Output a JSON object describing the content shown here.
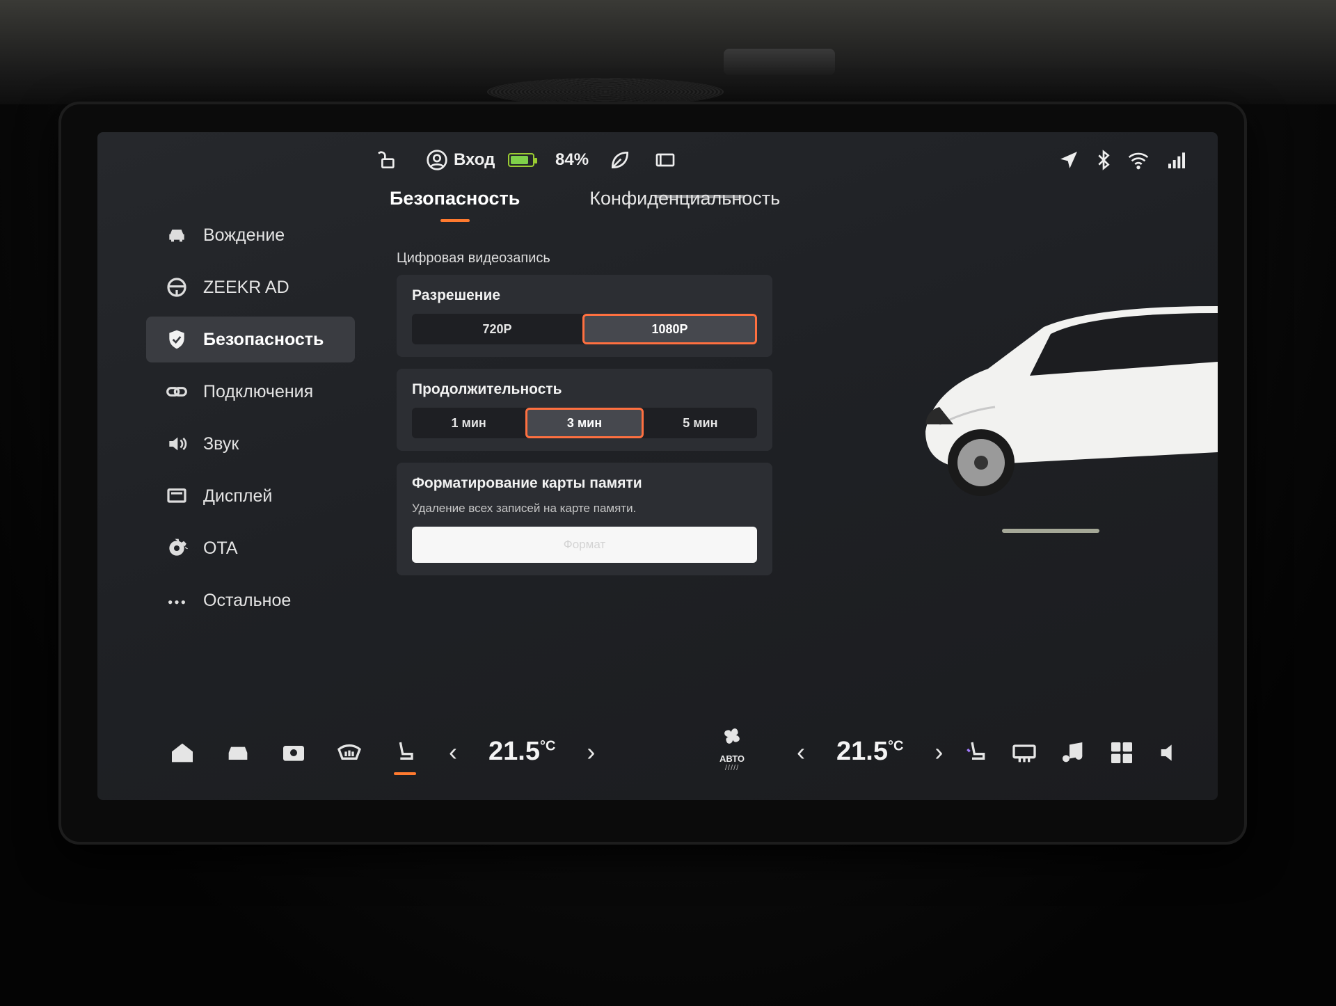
{
  "status_bar": {
    "login_label": "Вход",
    "battery_percent": "84%",
    "battery_level": 0.84,
    "battery_color": "#7fd14a",
    "icons": [
      "unlock-icon",
      "user-icon",
      "leaf-icon",
      "screen-icon",
      "navigation-icon",
      "bluetooth-icon",
      "wifi-icon",
      "signal-icon"
    ]
  },
  "sidebar": {
    "items": [
      {
        "label": "Вождение",
        "icon": "car-icon"
      },
      {
        "label": "ZEEKR AD",
        "icon": "steering-wheel-icon"
      },
      {
        "label": "Безопасность",
        "icon": "shield-icon",
        "active": true
      },
      {
        "label": "Подключения",
        "icon": "link-icon"
      },
      {
        "label": "Звук",
        "icon": "speaker-icon"
      },
      {
        "label": "Дисплей",
        "icon": "display-icon"
      },
      {
        "label": "OTA",
        "icon": "gear-icon"
      },
      {
        "label": "Остальное",
        "icon": "more-icon"
      }
    ]
  },
  "tabs": [
    {
      "label": "Безопасность",
      "active": true
    },
    {
      "label": "Конфиденциальность",
      "active": false
    }
  ],
  "dashcam": {
    "section_title": "Цифровая видеозапись",
    "resolution": {
      "title": "Разрешение",
      "options": [
        "720P",
        "1080P"
      ],
      "selected": "1080P"
    },
    "duration": {
      "title": "Продолжительность",
      "options": [
        "1 мин",
        "3 мин",
        "5 мин"
      ],
      "selected": "3 мин"
    },
    "format": {
      "title": "Форматирование карты памяти",
      "description": "Удаление всех записей на карте памяти.",
      "button_label": "Формат"
    }
  },
  "climate": {
    "driver_temp": "21.5",
    "passenger_temp": "21.5",
    "unit": "°C",
    "fan_mode": "АВТО",
    "fan_level_marks": "/////"
  },
  "dock": {
    "icons": [
      "home-icon",
      "car-icon",
      "camera-360-icon",
      "defrost-icon",
      "seat-icon",
      "seat-heat-icon",
      "rear-defrost-icon",
      "music-icon",
      "apps-icon",
      "volume-icon"
    ]
  },
  "accent_color": "#ff7a2f"
}
